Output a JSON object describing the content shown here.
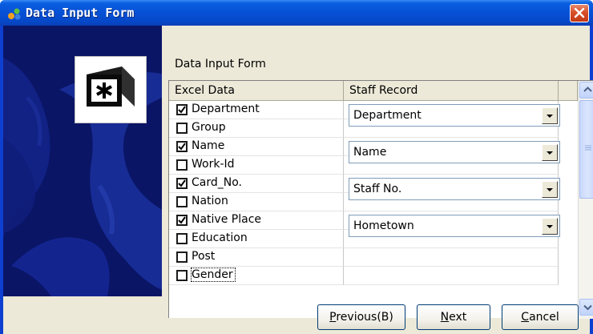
{
  "window": {
    "title": "Data Input Form"
  },
  "form": {
    "heading": "Data Input Form"
  },
  "grid": {
    "columns": [
      "Excel Data",
      "Staff Record"
    ],
    "rows": [
      {
        "label": "Department",
        "checked": true,
        "mapping": "Department"
      },
      {
        "label": "Group",
        "checked": false,
        "mapping": ""
      },
      {
        "label": "Name",
        "checked": true,
        "mapping": "Name"
      },
      {
        "label": "Work-Id",
        "checked": false,
        "mapping": ""
      },
      {
        "label": "Card_No.",
        "checked": true,
        "mapping": "Staff No."
      },
      {
        "label": "Nation",
        "checked": false,
        "mapping": ""
      },
      {
        "label": "Native Place",
        "checked": true,
        "mapping": "Hometown"
      },
      {
        "label": "Education",
        "checked": false,
        "mapping": ""
      },
      {
        "label": "Post",
        "checked": false,
        "mapping": ""
      },
      {
        "label": "Gender",
        "checked": false,
        "mapping": ""
      }
    ]
  },
  "buttons": {
    "previous": {
      "label": "Previous(B)",
      "mnemonic": "P"
    },
    "next": {
      "label": "Next",
      "mnemonic": "N"
    },
    "cancel": {
      "label": "Cancel",
      "mnemonic": "C"
    }
  },
  "icons": {
    "app": "app-icon",
    "close": "close-icon",
    "logo": "asterisk-box-icon",
    "checkbox": "check-icon",
    "dropdown": "chevron-down-icon",
    "scroll_up": "scroll-up-arrow-icon",
    "scroll_down": "scroll-down-arrow-icon"
  },
  "colors": {
    "titlebar": "#0650d6",
    "dialog_bg": "#ece9d8",
    "banner_bg": "#0a1566",
    "close_button": "#d8502a"
  }
}
